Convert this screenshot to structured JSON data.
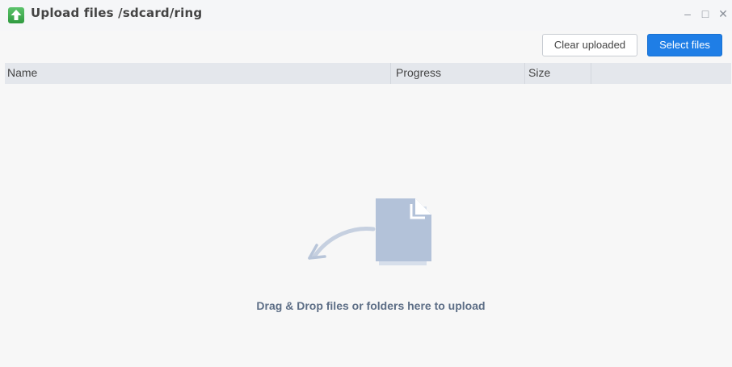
{
  "window": {
    "title": "Upload files /sdcard/ring",
    "icon": "upload-icon",
    "controls": [
      "minimize-icon",
      "maximize-icon",
      "close-icon"
    ]
  },
  "toolbar": {
    "clear_label": "Clear uploaded",
    "select_label": "Select files"
  },
  "table": {
    "columns": [
      "Name",
      "Progress",
      "Size"
    ],
    "rows": []
  },
  "drop_zone": {
    "message": "Drag & Drop files or folders here to upload",
    "icon": "file-drop-icon"
  },
  "colors": {
    "accent": "#1f7ee6",
    "upload_icon": "#3aab4a",
    "illustration": "#b3c2d9"
  }
}
